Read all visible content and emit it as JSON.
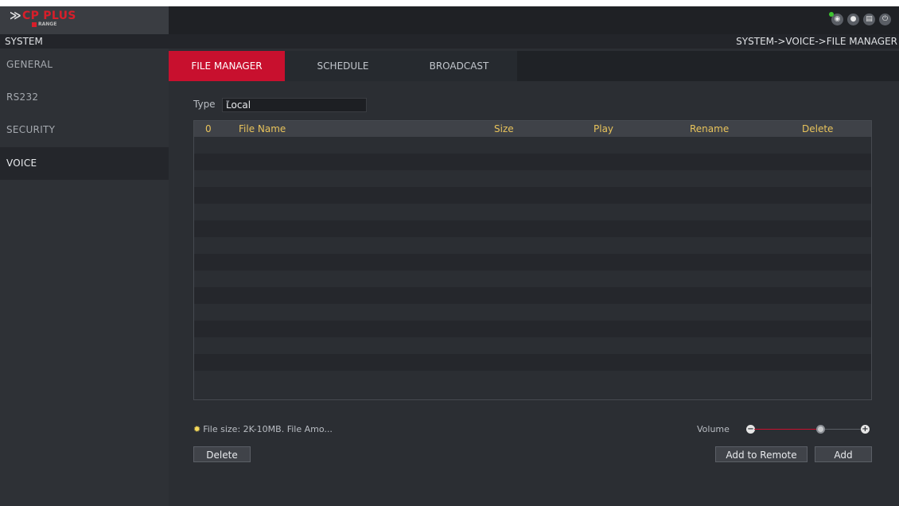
{
  "colors": {
    "accent": "#c8102e",
    "header_text": "#e8c35b",
    "status_green": "#3ec531"
  },
  "logo": {
    "mark": "≫",
    "brand": "CP PLUS",
    "sub": "RANGE"
  },
  "top_icons": [
    "eye-icon",
    "user-icon",
    "chat-icon",
    "power-icon"
  ],
  "title": {
    "section": "SYSTEM",
    "breadcrumb": "SYSTEM->VOICE->FILE MANAGER"
  },
  "sidebar": {
    "items": [
      {
        "label": "GENERAL"
      },
      {
        "label": "RS232"
      },
      {
        "label": "SECURITY"
      },
      {
        "label": "VOICE",
        "active": true
      }
    ]
  },
  "tabs": [
    {
      "label": "FILE MANAGER",
      "active": true
    },
    {
      "label": "SCHEDULE"
    },
    {
      "label": "BROADCAST"
    }
  ],
  "type_filter": {
    "label": "Type",
    "value": "Local"
  },
  "table": {
    "columns": [
      "0",
      "File Name",
      "Size",
      "Play",
      "Rename",
      "Delete"
    ],
    "rows": []
  },
  "hint": "File size: 2K-10MB. File Amo...",
  "volume": {
    "label": "Volume",
    "level": 0.62
  },
  "buttons": {
    "delete": "Delete",
    "add_to_remote": "Add to Remote",
    "add": "Add"
  }
}
